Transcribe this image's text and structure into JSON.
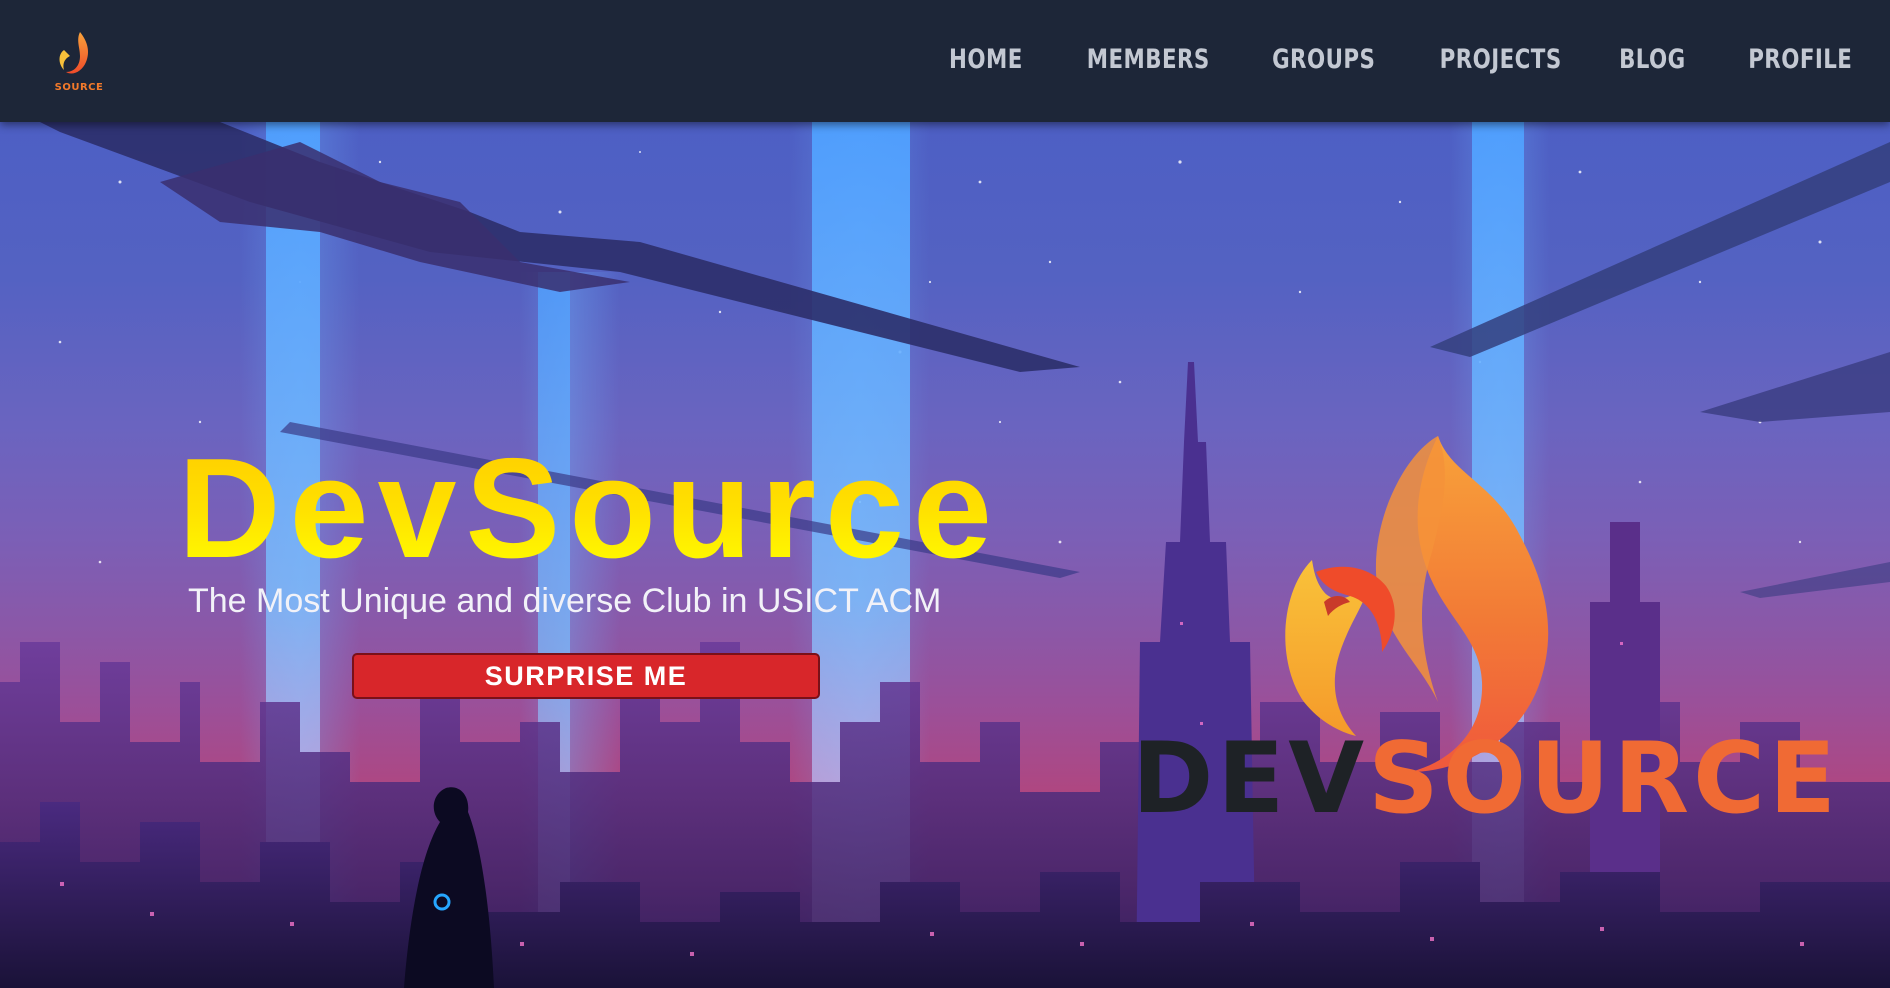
{
  "navbar": {
    "logo_text": "SOURCE",
    "items": [
      {
        "label": "HOME"
      },
      {
        "label": "MEMBERS"
      },
      {
        "label": "GROUPS"
      },
      {
        "label": "PROJECTS"
      },
      {
        "label": "BLOG"
      },
      {
        "label": "PROFILE"
      }
    ]
  },
  "hero": {
    "title": "DevSource",
    "subtitle": "The Most Unique and diverse Club in USICT ACM",
    "cta_label": "SURPRISE ME",
    "brand_logo": {
      "dev": "DEV",
      "source": "SOURCE"
    }
  },
  "colors": {
    "navbar_bg": "#1d2638",
    "nav_text": "#c3c8d2",
    "title_yellow": "#ffe100",
    "cta_red": "#d8262a",
    "brand_orange": "#f06a34"
  }
}
